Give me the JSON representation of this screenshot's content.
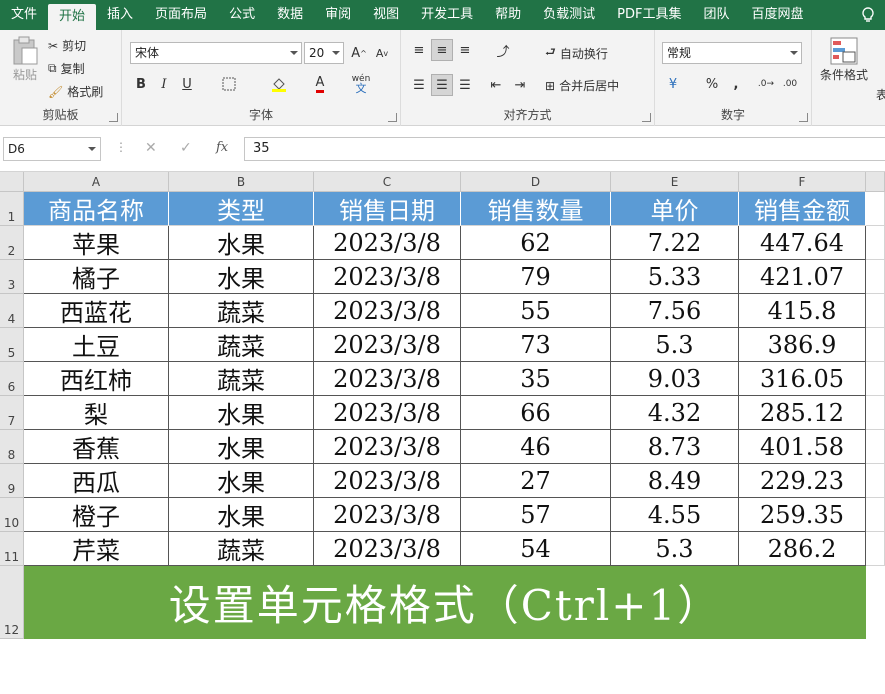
{
  "menu": {
    "tabs": [
      "文件",
      "开始",
      "插入",
      "页面布局",
      "公式",
      "数据",
      "审阅",
      "视图",
      "开发工具",
      "帮助",
      "负载测试",
      "PDF工具集",
      "团队",
      "百度网盘"
    ],
    "active": "开始"
  },
  "ribbon": {
    "clipboard": {
      "paste": "粘贴",
      "cut": "剪切",
      "copy": "复制",
      "format_painter": "格式刷",
      "label": "剪贴板"
    },
    "font": {
      "name": "宋体",
      "size": "20",
      "bold": "B",
      "italic": "I",
      "underline": "U",
      "wen": "wén",
      "label": "字体"
    },
    "alignment": {
      "wrap": "自动换行",
      "merge": "合并后居中",
      "label": "对齐方式"
    },
    "number": {
      "format": "常规",
      "percent": "%",
      "comma": ",",
      "label": "数字"
    },
    "styles": {
      "conditional": "条件格式",
      "partial": "表"
    }
  },
  "formula_bar": {
    "name_box": "D6",
    "cancel": "✕",
    "enter": "✓",
    "fx": "fx",
    "value": "35"
  },
  "columns": [
    "A",
    "B",
    "C",
    "D",
    "E",
    "F"
  ],
  "rows": [
    "1",
    "2",
    "3",
    "4",
    "5",
    "6",
    "7",
    "8",
    "9",
    "10",
    "11",
    "12"
  ],
  "table": {
    "headers": [
      "商品名称",
      "类型",
      "销售日期",
      "销售数量",
      "单价",
      "销售金额"
    ],
    "data": [
      [
        "苹果",
        "水果",
        "2023/3/8",
        "62",
        "7.22",
        "447.64"
      ],
      [
        "橘子",
        "水果",
        "2023/3/8",
        "79",
        "5.33",
        "421.07"
      ],
      [
        "西蓝花",
        "蔬菜",
        "2023/3/8",
        "55",
        "7.56",
        "415.8"
      ],
      [
        "土豆",
        "蔬菜",
        "2023/3/8",
        "73",
        "5.3",
        "386.9"
      ],
      [
        "西红柿",
        "蔬菜",
        "2023/3/8",
        "35",
        "9.03",
        "316.05"
      ],
      [
        "梨",
        "水果",
        "2023/3/8",
        "66",
        "4.32",
        "285.12"
      ],
      [
        "香蕉",
        "水果",
        "2023/3/8",
        "46",
        "8.73",
        "401.58"
      ],
      [
        "西瓜",
        "水果",
        "2023/3/8",
        "27",
        "8.49",
        "229.23"
      ],
      [
        "橙子",
        "水果",
        "2023/3/8",
        "57",
        "4.55",
        "259.35"
      ],
      [
        "芹菜",
        "蔬菜",
        "2023/3/8",
        "54",
        "5.3",
        "286.2"
      ]
    ]
  },
  "banner": "设置单元格格式（Ctrl+1）",
  "colors": {
    "menu_bg": "#217346",
    "header_fill": "#5b9bd5",
    "banner_fill": "#6aa844"
  }
}
